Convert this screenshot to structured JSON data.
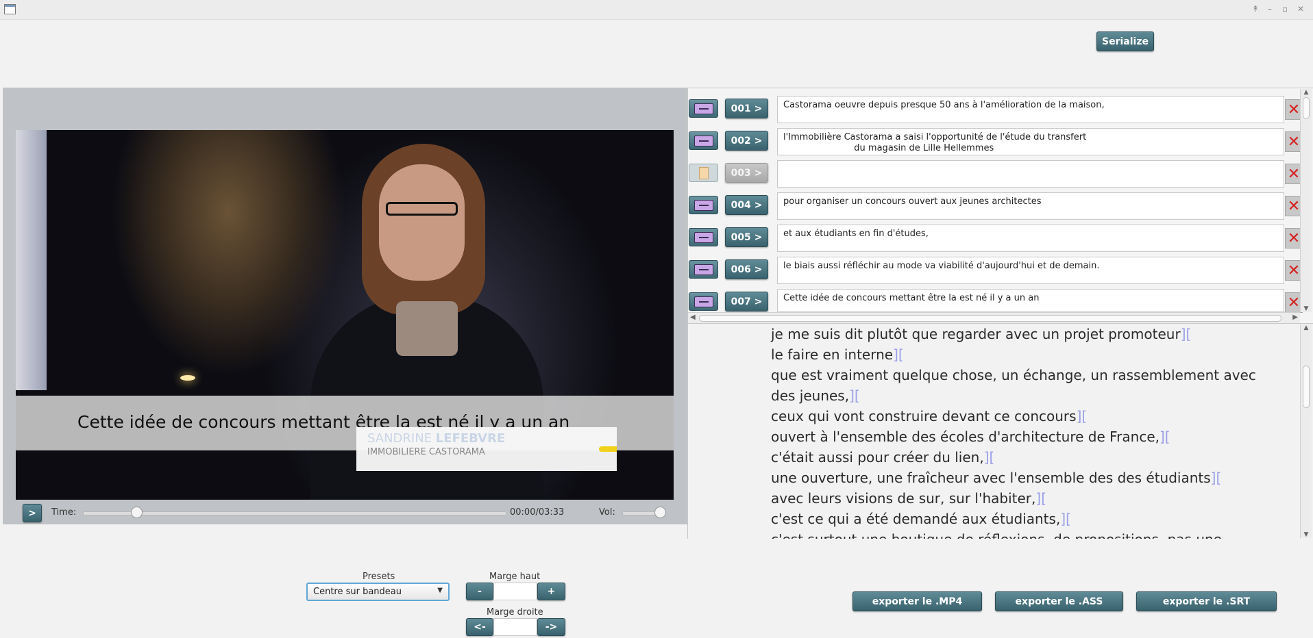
{
  "window": {
    "controls": [
      "↟",
      "–",
      "▫",
      "✕"
    ]
  },
  "toolbar": {
    "serialize_label": "Serialize"
  },
  "video": {
    "subtitle": "Cette idée de concours mettant être la est né il y a un an",
    "lower_third": {
      "first_name": "SANDRINE",
      "last_name": "LEFEBVRE",
      "company": "IMMOBILIERE CASTORAMA"
    }
  },
  "player": {
    "play_label": ">",
    "time_label": "Time:",
    "time_value": "00:00/03:33",
    "vol_label": "Vol:",
    "progress": 0.125,
    "volume": 0.9
  },
  "subtitles": [
    {
      "num": "001 >",
      "text": "Castorama oeuvre depuis presque 50 ans à l'amélioration de la maison,"
    },
    {
      "num": "002 >",
      "text": "l'Immobilière Castorama a saisi l'opportunité de l'étude du transfert\n                         du magasin de Lille Hellemmes"
    },
    {
      "num": "003 >",
      "text": ""
    },
    {
      "num": "004 >",
      "text": "pour organiser un concours ouvert aux jeunes architectes"
    },
    {
      "num": "005 >",
      "text": "et aux étudiants en fin d'études,"
    },
    {
      "num": "006 >",
      "text": "le biais aussi réfléchir au mode va viabilité d'aujourd'hui et de demain."
    },
    {
      "num": "007 >",
      "text": "Cette idée de concours mettant être la est né il y a un an"
    }
  ],
  "delete_icon": "✕",
  "script": {
    "marker": "][",
    "lines": [
      "je me suis dit plutôt que regarder avec un projet promoteur",
      "le faire en interne",
      "que est vraiment quelque chose, un échange, un rassemblement avec",
      "des jeunes,",
      "ceux qui vont construire devant ce concours",
      "ouvert à l'ensemble des écoles d'architecture de France,",
      "c'était aussi pour créer du lien,",
      "une ouverture, une fraîcheur avec l'ensemble des des étudiants",
      "avec leurs visions de sur, sur l'habiter,",
      "c'est ce qui a été demandé aux étudiants,",
      "c'est surtout une boutique de réflexions, de propositions, pas une"
    ]
  },
  "presets": {
    "label": "Presets",
    "selected": "Centre sur bandeau"
  },
  "marge_haut": {
    "label": "Marge haut",
    "minus": "-",
    "plus": "+",
    "value": ""
  },
  "marge_droite": {
    "label": "Marge droite",
    "left": "<-",
    "right": "->",
    "value": ""
  },
  "exports": {
    "mp4": "exporter le .MP4",
    "ass": "exporter le .ASS",
    "srt": "exporter le .SRT"
  }
}
